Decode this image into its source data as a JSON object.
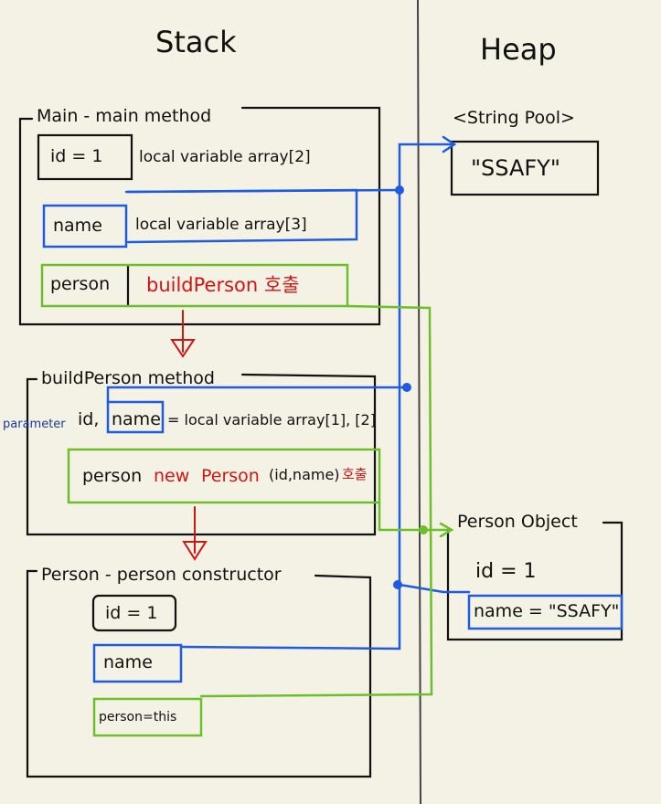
{
  "titles": {
    "stack": "Stack",
    "heap": "Heap"
  },
  "main_frame": {
    "label": "Main - main method",
    "id_var": "id = 1",
    "id_desc": "local variable array[2]",
    "name_var": "name",
    "name_desc": "local variable array[3]",
    "person_var": "person",
    "person_desc": "buildPerson 호출"
  },
  "build_frame": {
    "label": "buildPerson method",
    "param_tag": "parameter",
    "params_prefix": "id,",
    "param_name": "name",
    "params_desc": "= local variable array[1], [2]",
    "person_var": "person",
    "new_kw": "new",
    "new_call": "Person",
    "new_args": "(id,name)",
    "call_word": "호출"
  },
  "ctor_frame": {
    "label": "Person - person constructor",
    "id_var": "id = 1",
    "name_var": "name",
    "this_var": "person=this"
  },
  "heap": {
    "pool_label": "<String Pool>",
    "pool_value": "\"SSAFY\"",
    "obj_label": "Person Object",
    "obj_id": "id = 1",
    "obj_name": "name = \"SSAFY\""
  },
  "colors": {
    "blue": "#1f5be0",
    "green": "#6cbf2a",
    "red": "#d11414",
    "ink": "#111111"
  }
}
